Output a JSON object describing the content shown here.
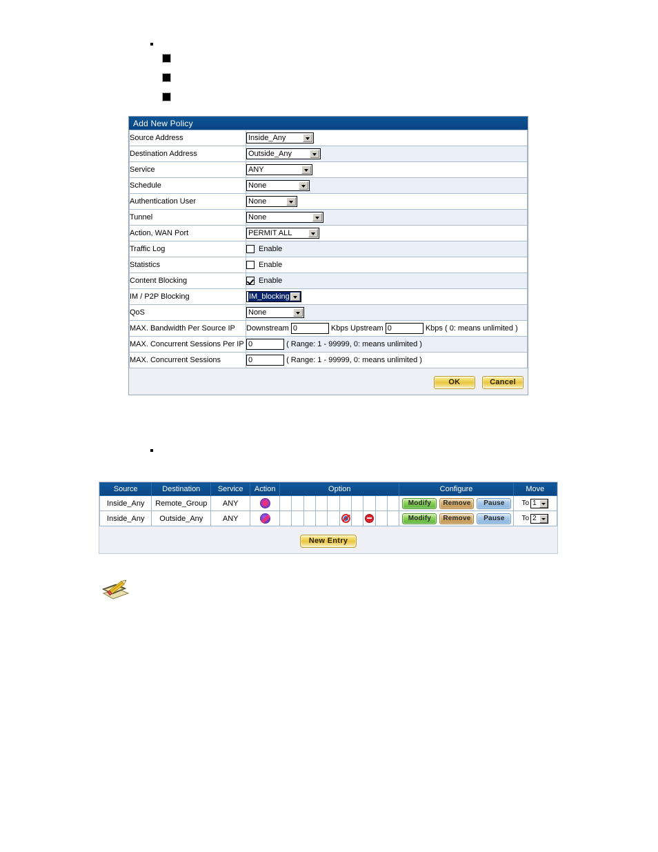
{
  "bullets": [
    {
      "name": "bullet-disc",
      "marker": "disc"
    },
    {
      "name": "bullet-square-1",
      "marker": "square"
    },
    {
      "name": "bullet-square-2",
      "marker": "square"
    },
    {
      "name": "bullet-square-3",
      "marker": "square"
    },
    {
      "name": "bullet-disc-2",
      "marker": "disc"
    }
  ],
  "colors": {
    "header_blue": "#0b4d8f",
    "panel_bg": "#eef0f5",
    "label_bg": "#f4f7fb",
    "row_alt_bg": "#eaf0f7",
    "gold_button": "#e8c63d",
    "modify_green": "#8ed35b",
    "remove_tan": "#d9b377",
    "pause_blue": "#a8c9e8",
    "action_purple": "#7b3fd0",
    "prohibit_red": "#d8232a",
    "select_highlight": "#0a246a"
  },
  "policy_form": {
    "title": "Add New Policy",
    "rows": [
      {
        "label": "Source Address",
        "type": "select",
        "value": "Inside_Any",
        "width_class": "w-src"
      },
      {
        "label": "Destination Address",
        "type": "select",
        "value": "Outside_Any",
        "width_class": "w-dst"
      },
      {
        "label": "Service",
        "type": "select",
        "value": "ANY",
        "width_class": "w-svc"
      },
      {
        "label": "Schedule",
        "type": "select",
        "value": "None",
        "width_class": "w-sched"
      },
      {
        "label": "Authentication User",
        "type": "select",
        "value": "None",
        "width_class": "w-auth"
      },
      {
        "label": "Tunnel",
        "type": "select",
        "value": "None",
        "width_class": "w-tun"
      },
      {
        "label": "Action, WAN Port",
        "type": "select",
        "value": "PERMIT ALL",
        "width_class": "w-act"
      },
      {
        "label": "Traffic Log",
        "type": "checkbox",
        "value": "Enable",
        "checked": false
      },
      {
        "label": "Statistics",
        "type": "checkbox",
        "value": "Enable",
        "checked": false
      },
      {
        "label": "Content Blocking",
        "type": "checkbox",
        "value": "Enable",
        "checked": true
      },
      {
        "label": "IM / P2P Blocking",
        "type": "select",
        "value": "IM_blocking",
        "width_class": "w-im",
        "highlighted": true
      },
      {
        "label": "QoS",
        "type": "select",
        "value": "None",
        "width_class": "w-qos"
      },
      {
        "label": "MAX. Bandwidth Per Source IP",
        "type": "bandwidth"
      },
      {
        "label": "MAX. Concurrent Sessions Per IP",
        "type": "sessions",
        "value": "0",
        "hint": "( Range: 1 - 99999, 0: means unlimited )"
      },
      {
        "label": "MAX. Concurrent Sessions",
        "type": "sessions",
        "value": "0",
        "hint": "( Range: 1 - 99999, 0: means unlimited )"
      }
    ],
    "bandwidth": {
      "downstream_label": "Downstream",
      "downstream_value": "0",
      "downstream_unit": "Kbps",
      "upstream_label": "Upstream",
      "upstream_value": "0",
      "upstream_unit": "Kbps",
      "hint": "( 0: means unlimited )"
    },
    "buttons": {
      "ok": "OK",
      "cancel": "Cancel"
    }
  },
  "policy_list": {
    "headers": {
      "source": "Source",
      "destination": "Destination",
      "service": "Service",
      "action": "Action",
      "option": "Option",
      "configure": "Configure",
      "move": "Move"
    },
    "rows": [
      {
        "source": "Inside_Any",
        "destination": "Remote_Group",
        "service": "ANY",
        "action_icon": "action-permit-star-icon",
        "options": [],
        "configure": {
          "modify": "Modify",
          "remove": "Remove",
          "pause": "Pause"
        },
        "move_label": "To",
        "move_value": "1"
      },
      {
        "source": "Inside_Any",
        "destination": "Outside_Any",
        "service": "ANY",
        "action_icon": "action-permit-slash-icon",
        "options": [
          "im-blocking-icon",
          "content-blocking-icon"
        ],
        "configure": {
          "modify": "Modify",
          "remove": "Remove",
          "pause": "Pause"
        },
        "move_label": "To",
        "move_value": "2"
      }
    ],
    "new_entry_label": "New Entry"
  },
  "note": {
    "icon": "note-pencil-icon"
  }
}
